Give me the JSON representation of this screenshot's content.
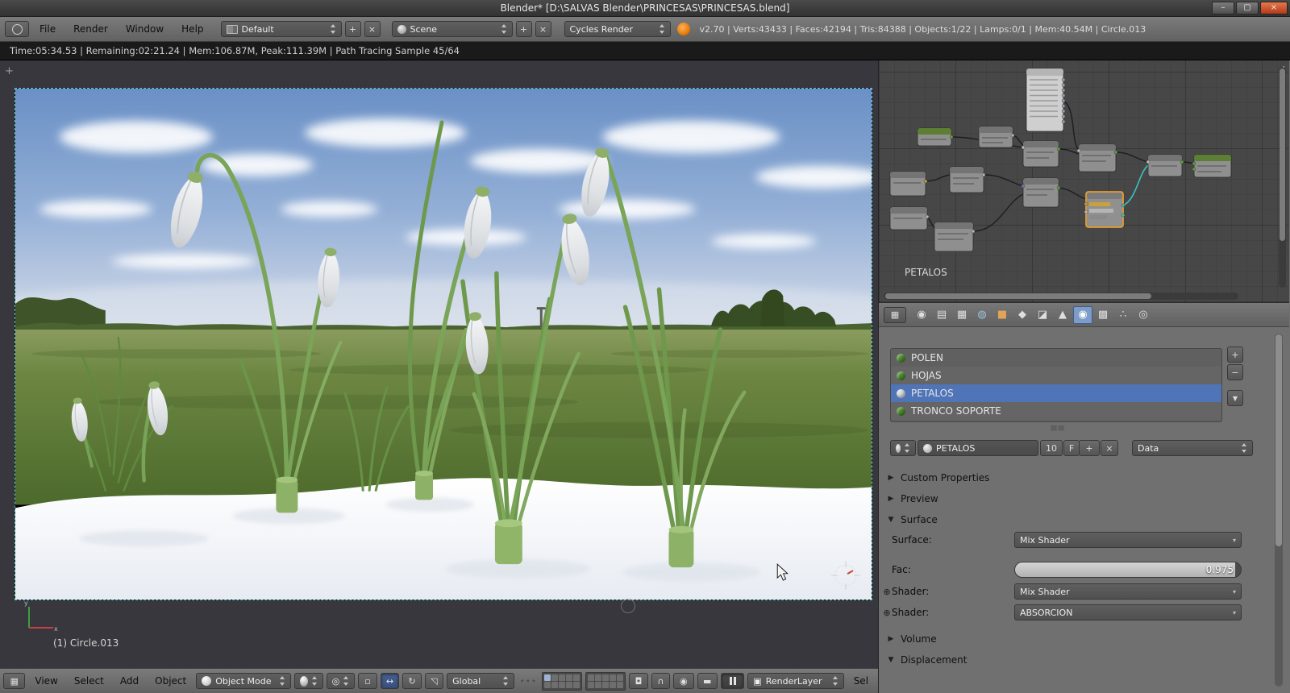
{
  "window": {
    "title": "Blender* [D:\\SALVAS Blender\\PRINCESAS\\PRINCESAS.blend]",
    "controls": {
      "minimize": "–",
      "maximize": "▢",
      "close": "×"
    }
  },
  "icons": {
    "tri_right": "▶",
    "tri_down": "▼",
    "plus": "+",
    "minus": "−",
    "close_x": "×",
    "circle_plus": "⊕",
    "grip": "≡≡",
    "grip_dots": "∙∙∙",
    "collapse_left": "◂",
    "region_plus": "+",
    "editor_grid": "▦",
    "menu_ind": "▾",
    "arrow_translate": "↔",
    "arrow_rotate": "↻",
    "arrow_scale": "◹",
    "pivot": "◎",
    "pivot_dot": "▫",
    "magnet": "∩",
    "lock": "◘",
    "camera": "◉",
    "clapper": "▬",
    "screen": "▣",
    "tab_render": "◉",
    "tab_render_layers": "▤",
    "tab_scene": "▦",
    "tab_world": "◍",
    "tab_object": "■",
    "tab_constraints": "◆",
    "tab_modifiers": "◪",
    "tab_data": "▲",
    "tab_material": "◉",
    "tab_texture": "▩",
    "tab_particles": "∴",
    "tab_physics": "◎"
  },
  "menubar": {
    "menus": [
      "File",
      "Render",
      "Window",
      "Help"
    ],
    "layout": "Default",
    "scene": "Scene",
    "engine": "Cycles Render",
    "stats": "v2.70 | Verts:43433 | Faces:42194 | Tris:84388 | Objects:1/22 | Lamps:0/1 | Mem:40.54M | Circle.013"
  },
  "status": {
    "line": "Time:05:34.53 | Remaining:02:21.24 | Mem:106.87M, Peak:111.39M | Path Tracing Sample 45/64"
  },
  "viewport": {
    "object_info": "(1) Circle.013"
  },
  "node_editor": {
    "frame_label": "PETALOS"
  },
  "properties": {
    "accent_color": "#4f74b8",
    "selection_color": "#e8a33a",
    "materials": [
      {
        "name": "POLEN",
        "color": "#4a8a2f"
      },
      {
        "name": "HOJAS",
        "color": "#4a8a2f"
      },
      {
        "name": "PETALOS",
        "color": "#d8dbde"
      },
      {
        "name": "TRONCO SOPORTE",
        "color": "#4a8a2f"
      }
    ],
    "datablock": {
      "name": "PETALOS",
      "users": "10",
      "fake_user": "F",
      "link_mode": "Data"
    },
    "panels": {
      "custom_properties": "Custom Properties",
      "preview": "Preview",
      "surface": "Surface",
      "volume": "Volume",
      "displacement": "Displacement"
    },
    "surface": {
      "surface_label": "Surface:",
      "surface_value": "Mix Shader",
      "fac_label": "Fac:",
      "fac_value": "0.975",
      "shader1_label": "Shader:",
      "shader1_value": "Mix Shader",
      "shader2_label": "Shader:",
      "shader2_value": "ABSORCION"
    }
  },
  "footer": {
    "menus": [
      "View",
      "Select",
      "Add",
      "Object"
    ],
    "mode": "Object Mode",
    "orientation": "Global",
    "render_layer": "RenderLayer",
    "clipped": "Sel"
  }
}
